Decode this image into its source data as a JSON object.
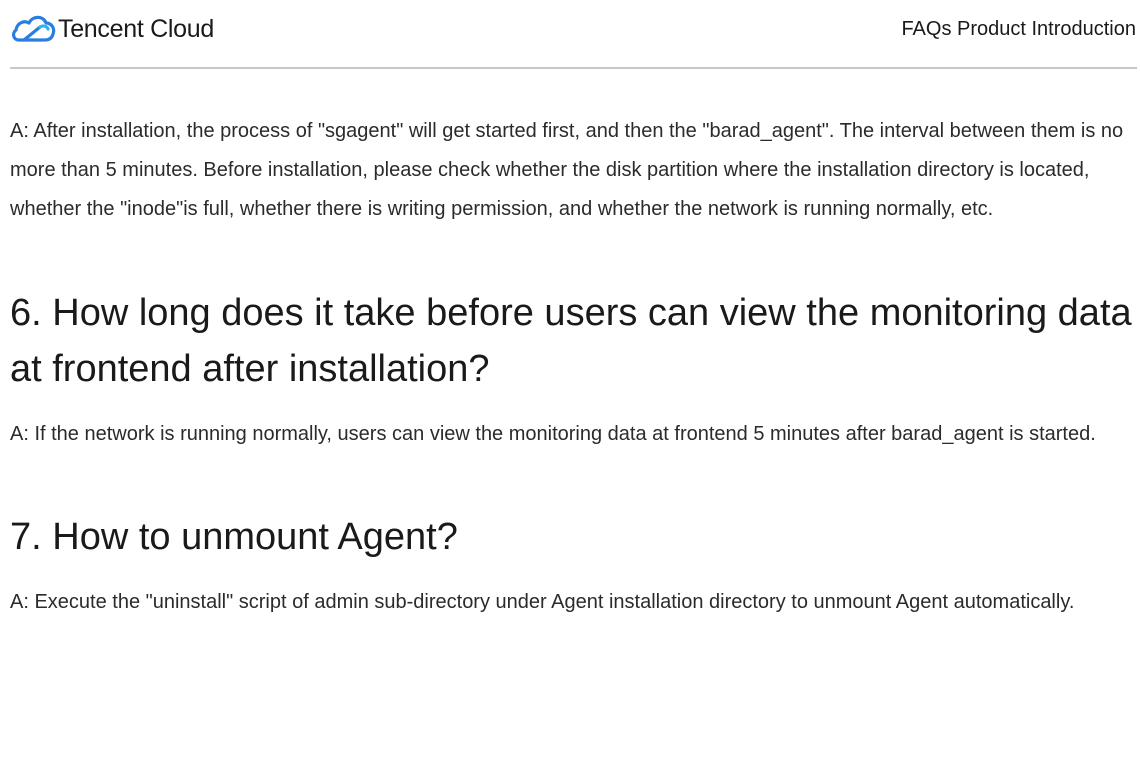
{
  "header": {
    "brand": "Tencent Cloud",
    "logo_icon": "tencent-cloud-logo-icon",
    "doc_title": "FAQs Product Introduction",
    "brand_color": "#2a7de1"
  },
  "content": {
    "answer_5": "A: After installation, the process of \"sgagent\" will get started first, and then the \"barad_agent\". The interval between them is no more than 5 minutes. Before installation, please check whether the disk partition where the installation directory is located, whether the \"inode\"is full, whether there is writing permission, and whether the network is running normally, etc.",
    "question_6": "6. How long does it take before users can view the monitoring data at frontend after installation?",
    "answer_6": "A: If the network is running normally, users can view the monitoring data at frontend 5 minutes after barad_agent is started.",
    "question_7": "7. How to unmount Agent?",
    "answer_7": "A: Execute the \"uninstall\" script of admin sub-directory under Agent installation directory to unmount Agent automatically."
  }
}
